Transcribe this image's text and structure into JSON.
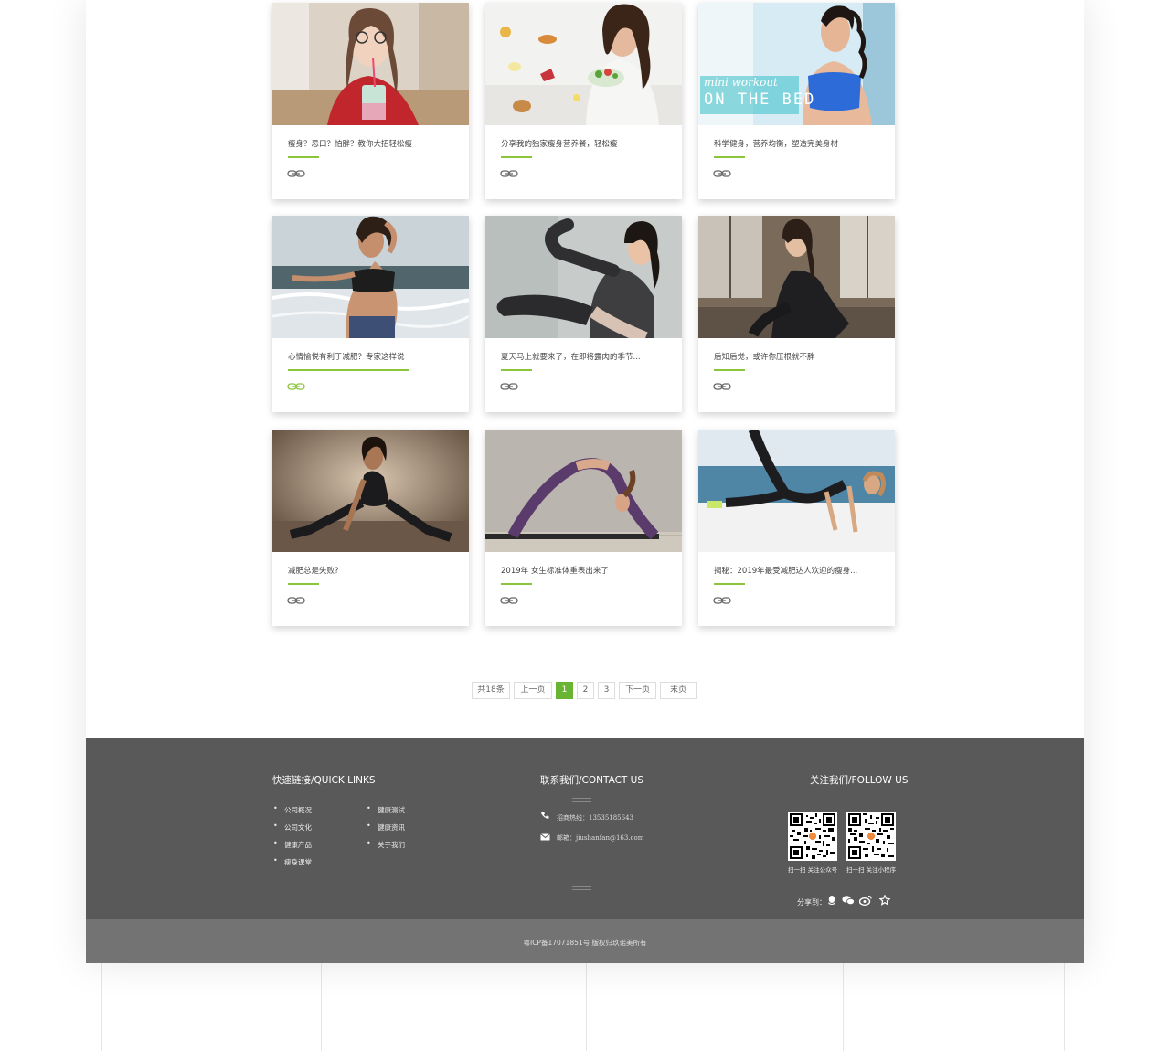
{
  "articles": [
    {
      "title": "瘦身？忌口？怕胖？教你大招轻松瘦"
    },
    {
      "title": "分享我的独家瘦身营养餐，轻松瘦"
    },
    {
      "title": "科学健身，营养均衡，塑造完美身材"
    },
    {
      "title": "心情愉悦有利于减肥？专家这样说"
    },
    {
      "title": "夏天马上就要来了，在即将露肉的季节..."
    },
    {
      "title": "后知后觉，或许你压根就不胖"
    },
    {
      "title": "减肥总是失败?"
    },
    {
      "title": "2019年 女生标准体重表出来了"
    },
    {
      "title": "揭秘：2019年最受减肥达人欢迎的瘦身..."
    }
  ],
  "image_overlay": {
    "line1": "mini workout",
    "line2": "ON THE BED"
  },
  "pagination": {
    "total": "共18条",
    "prev": "上一页",
    "pages": [
      "1",
      "2",
      "3"
    ],
    "current": "1",
    "next": "下一页",
    "last": "末页"
  },
  "footer": {
    "quick_links_title": "快速链接/QUICK  LINKS",
    "quick_links_col1": [
      "公司概况",
      "公司文化",
      "健康产品",
      "瘦身课堂"
    ],
    "quick_links_col2": [
      "健康测试",
      "健康资讯",
      "关于我们"
    ],
    "contact_title": "联系我们/CONTACT US",
    "hotline": "招商热线：13535185643",
    "email": "邮箱：jiushanfan@163.com",
    "follow_title": "关注我们/FOLLOW US",
    "qr1_caption": "扫一扫 关注公众号",
    "qr2_caption": "扫一扫 关注小程序",
    "share_label": "分享到：",
    "share_icons": [
      "qq-icon",
      "wechat-icon",
      "weibo-icon",
      "star-icon"
    ],
    "copyright": "粤ICP备17071851号 版权归玖诺美所有"
  },
  "colors": {
    "accent": "#6ab433",
    "underline": "#8ac53c",
    "footer_bg": "#595959",
    "copyright_bg": "#737373"
  }
}
